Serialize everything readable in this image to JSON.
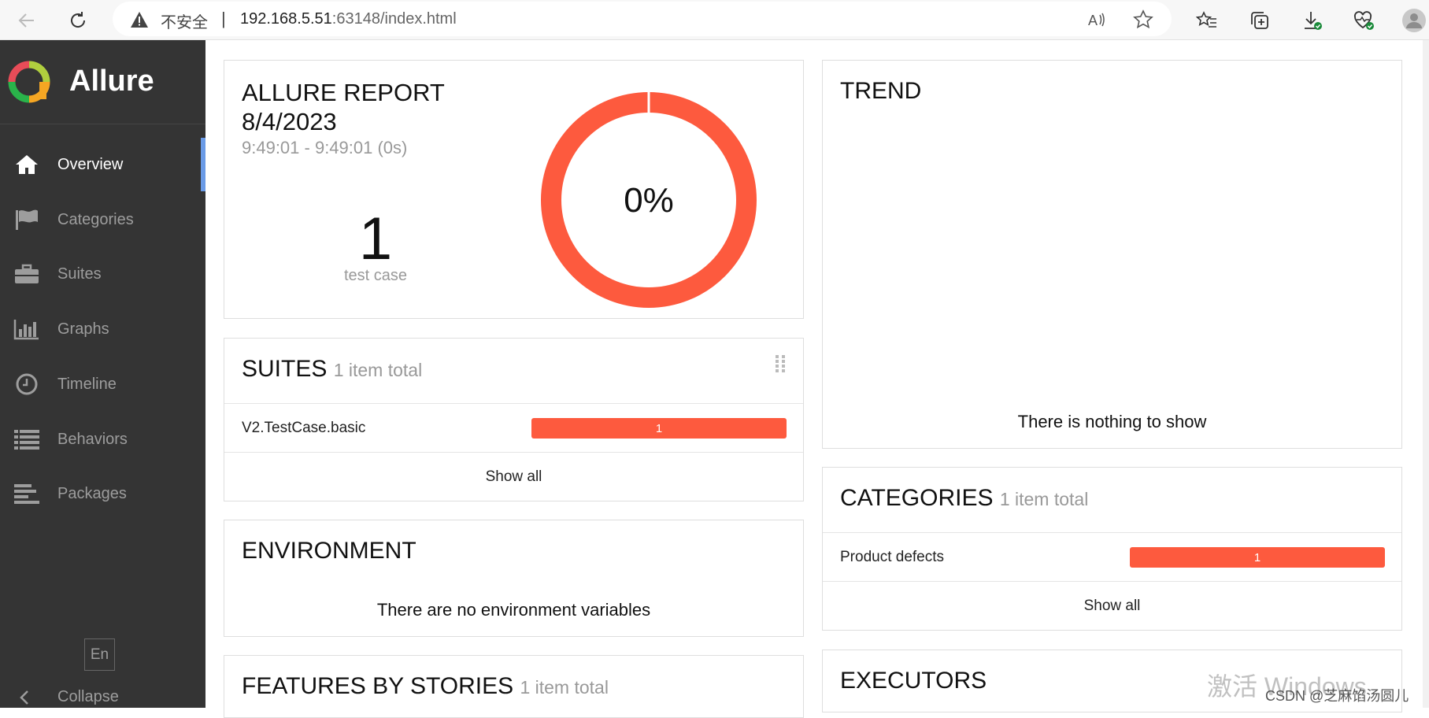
{
  "browser": {
    "insecure_label": "不安全",
    "separator": "|",
    "url_host": "192.168.5.51",
    "url_rest": ":63148/index.html"
  },
  "sidebar": {
    "brand": "Allure",
    "items": [
      {
        "label": "Overview",
        "icon": "home-icon",
        "active": true
      },
      {
        "label": "Categories",
        "icon": "flag-icon"
      },
      {
        "label": "Suites",
        "icon": "briefcase-icon"
      },
      {
        "label": "Graphs",
        "icon": "bar-chart-icon"
      },
      {
        "label": "Timeline",
        "icon": "clock-icon"
      },
      {
        "label": "Behaviors",
        "icon": "list-icon"
      },
      {
        "label": "Packages",
        "icon": "align-left-icon"
      }
    ],
    "language": "En",
    "collapse": "Collapse"
  },
  "summary": {
    "title_line1": "ALLURE REPORT",
    "title_line2": "8/4/2023",
    "time_range": "9:49:01 - 9:49:01 (0s)",
    "test_count": "1",
    "test_count_label": "test case",
    "pass_rate": "0%",
    "pass_rate_value": 0
  },
  "trend": {
    "title": "TREND",
    "empty": "There is nothing to show"
  },
  "suites": {
    "title": "SUITES",
    "count": "1 item total",
    "rows": [
      {
        "name": "V2.TestCase.basic",
        "value": "1"
      }
    ],
    "show_all": "Show all"
  },
  "categories": {
    "title": "CATEGORIES",
    "count": "1 item total",
    "rows": [
      {
        "name": "Product defects",
        "value": "1"
      }
    ],
    "show_all": "Show all"
  },
  "environment": {
    "title": "ENVIRONMENT",
    "empty": "There are no environment variables"
  },
  "features": {
    "title": "FEATURES BY STORIES",
    "count": "1 item total"
  },
  "executors": {
    "title": "EXECUTORS"
  },
  "overlay": {
    "watermark": "激活 Windows",
    "credit": "CSDN @芝麻馅汤圆儿"
  },
  "colors": {
    "failed": "#fd5a3e",
    "sidebar": "#343434",
    "active_accent": "#6a9be7"
  }
}
